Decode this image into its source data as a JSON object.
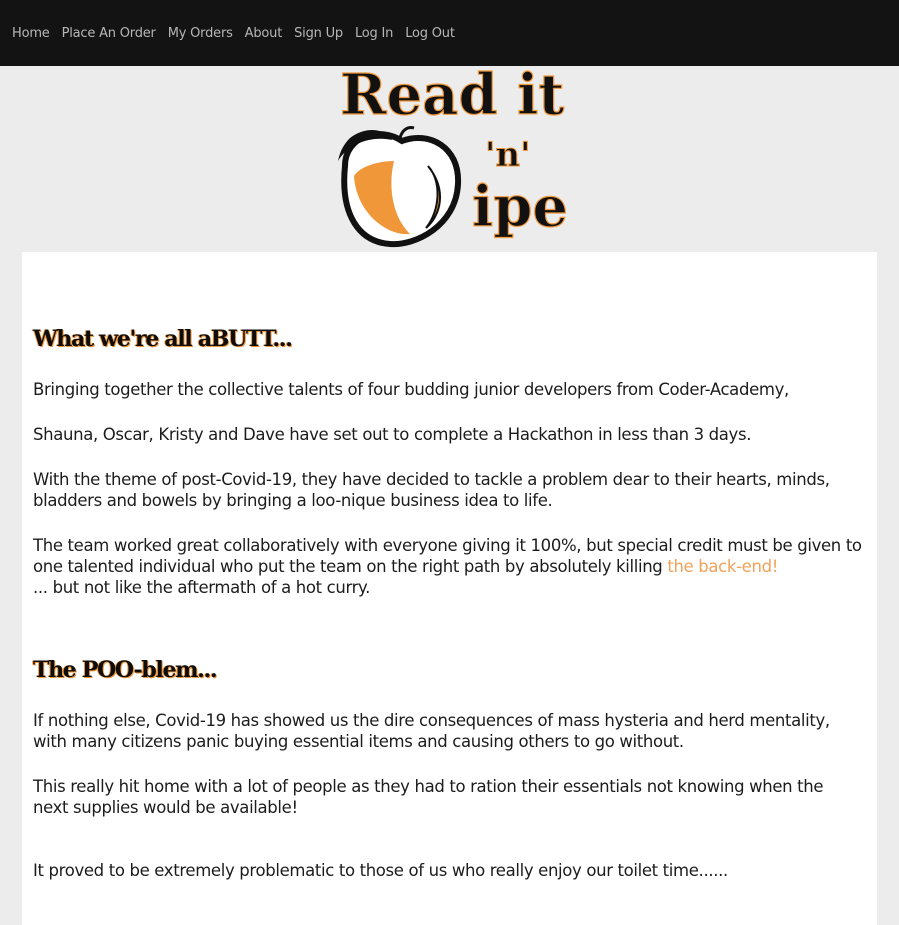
{
  "nav": {
    "items": [
      "Home",
      "Place An Order",
      "My Orders",
      "About",
      "Sign Up",
      "Log In",
      "Log Out"
    ]
  },
  "logo": {
    "line1": "Read it",
    "line2": "'n'",
    "line3": "ipe",
    "colors": {
      "ink": "#111111",
      "peach": "#f0973a"
    }
  },
  "section1": {
    "heading": "What we're all aBUTT...",
    "p1": "Bringing together the collective talents of four budding junior developers from Coder-Academy,",
    "p2": "Shauna, Oscar, Kristy and Dave have set out to complete a Hackathon in less than 3 days.",
    "p3": "With the theme of post-Covid-19, they have decided to tackle a problem dear to their hearts, minds, bladders and bowels by bringing a loo-nique business idea to life.",
    "p4_before": "The team worked great collaboratively with everyone giving it 100%, but special credit must be given to one talented individual who put the team on the right path by absolutely killing ",
    "p4_link": "the back-end!",
    "p4_after": "... but not like the aftermath of a hot curry."
  },
  "section2": {
    "heading": "The POO-blem...",
    "p1": "If nothing else, Covid-19 has showed us the dire consequences of mass hysteria and herd mentality, with many citizens panic buying essential items and causing others to go without.",
    "p2": "This really hit home with a lot of people as they had to ration their essentials not knowing when the next supplies would be available!",
    "p3": "It proved to be extremely problematic to those of us who really enjoy our toilet time......"
  },
  "colors": {
    "navbar": "#131313",
    "accent": "#f0a25a",
    "page_bg": "#ececec"
  }
}
